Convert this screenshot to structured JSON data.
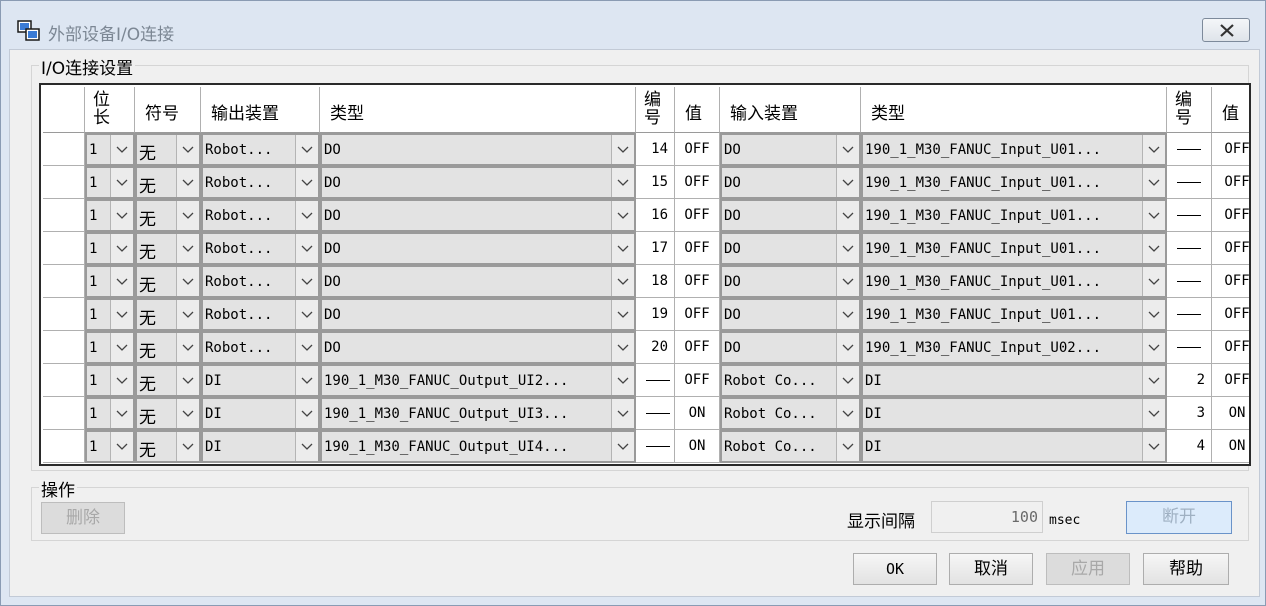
{
  "window": {
    "title": "外部设备I/O连接",
    "close_label": "✕"
  },
  "io_group": {
    "label": "I/O连接设置"
  },
  "ops_group": {
    "label": "操作"
  },
  "headers": {
    "bit_length": "位长",
    "sign": "符号",
    "output_device": "输出装置",
    "output_type": "类型",
    "out_no": "编号",
    "out_value": "值",
    "input_device": "输入装置",
    "input_type": "类型",
    "in_no": "编号",
    "in_value": "值"
  },
  "rows": [
    {
      "bit": "1",
      "sign": "无",
      "out_dev": "Robot...",
      "out_type": "DO",
      "out_no": "14",
      "out_val": "OFF",
      "in_dev": "DO",
      "in_type": "190_1_M30_FANUC_Input_U01...",
      "in_no": "—",
      "in_val": "OFF"
    },
    {
      "bit": "1",
      "sign": "无",
      "out_dev": "Robot...",
      "out_type": "DO",
      "out_no": "15",
      "out_val": "OFF",
      "in_dev": "DO",
      "in_type": "190_1_M30_FANUC_Input_U01...",
      "in_no": "—",
      "in_val": "OFF"
    },
    {
      "bit": "1",
      "sign": "无",
      "out_dev": "Robot...",
      "out_type": "DO",
      "out_no": "16",
      "out_val": "OFF",
      "in_dev": "DO",
      "in_type": "190_1_M30_FANUC_Input_U01...",
      "in_no": "—",
      "in_val": "OFF"
    },
    {
      "bit": "1",
      "sign": "无",
      "out_dev": "Robot...",
      "out_type": "DO",
      "out_no": "17",
      "out_val": "OFF",
      "in_dev": "DO",
      "in_type": "190_1_M30_FANUC_Input_U01...",
      "in_no": "—",
      "in_val": "OFF"
    },
    {
      "bit": "1",
      "sign": "无",
      "out_dev": "Robot...",
      "out_type": "DO",
      "out_no": "18",
      "out_val": "OFF",
      "in_dev": "DO",
      "in_type": "190_1_M30_FANUC_Input_U01...",
      "in_no": "—",
      "in_val": "OFF"
    },
    {
      "bit": "1",
      "sign": "无",
      "out_dev": "Robot...",
      "out_type": "DO",
      "out_no": "19",
      "out_val": "OFF",
      "in_dev": "DO",
      "in_type": "190_1_M30_FANUC_Input_U01...",
      "in_no": "—",
      "in_val": "OFF"
    },
    {
      "bit": "1",
      "sign": "无",
      "out_dev": "Robot...",
      "out_type": "DO",
      "out_no": "20",
      "out_val": "OFF",
      "in_dev": "DO",
      "in_type": "190_1_M30_FANUC_Input_U02...",
      "in_no": "—",
      "in_val": "OFF"
    },
    {
      "bit": "1",
      "sign": "无",
      "out_dev": "DI",
      "out_type": "190_1_M30_FANUC_Output_UI2...",
      "out_no": "—",
      "out_val": "OFF",
      "in_dev": "Robot Co...",
      "in_type": "DI",
      "in_no": "2",
      "in_val": "OFF"
    },
    {
      "bit": "1",
      "sign": "无",
      "out_dev": "DI",
      "out_type": "190_1_M30_FANUC_Output_UI3...",
      "out_no": "—",
      "out_val": "ON",
      "in_dev": "Robot Co...",
      "in_type": "DI",
      "in_no": "3",
      "in_val": "ON"
    },
    {
      "bit": "1",
      "sign": "无",
      "out_dev": "DI",
      "out_type": "190_1_M30_FANUC_Output_UI4...",
      "out_no": "—",
      "out_val": "ON",
      "in_dev": "Robot Co...",
      "in_type": "DI",
      "in_no": "4",
      "in_val": "ON"
    }
  ],
  "buttons": {
    "delete": "删除",
    "disconnect": "断开",
    "ok": "OK",
    "cancel": "取消",
    "apply": "应用",
    "help": "帮助"
  },
  "interval": {
    "label": "显示间隔",
    "value": "100",
    "unit": "msec"
  }
}
